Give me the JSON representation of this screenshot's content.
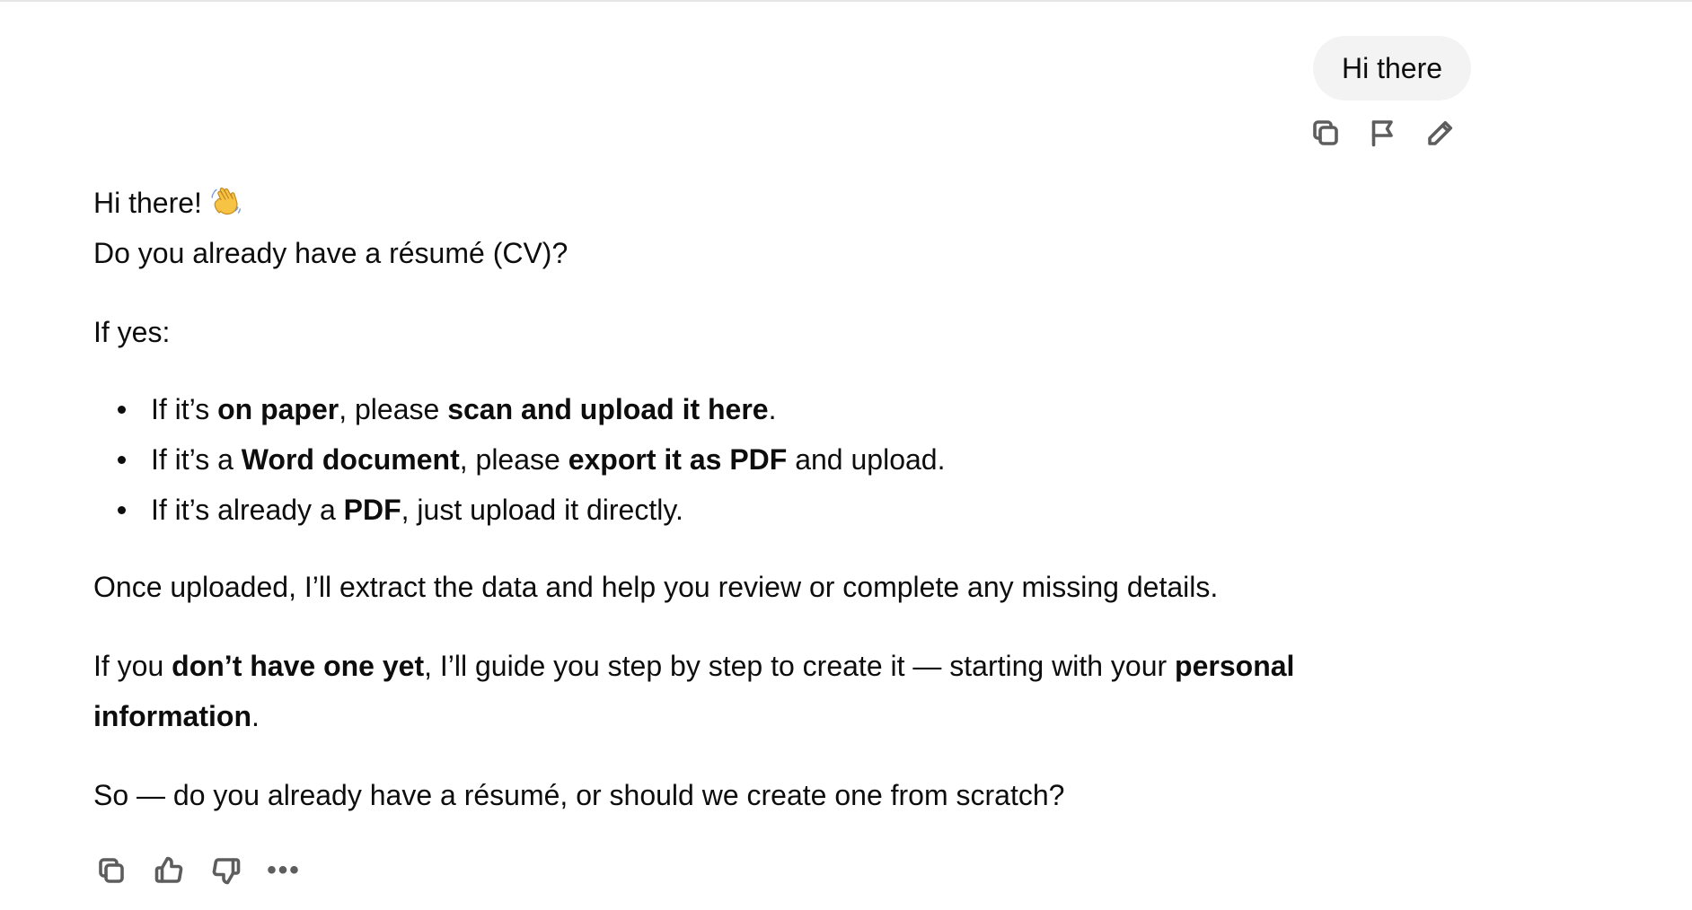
{
  "user_message": {
    "text": "Hi there"
  },
  "assistant_message": {
    "greeting": "Hi there!",
    "greeting_emoji": "waving-hand-icon",
    "question": "Do you already have a résumé (CV)?",
    "if_yes": "If yes:",
    "options": [
      {
        "pre": "If it’s ",
        "b1": "on paper",
        "mid": ", please ",
        "b2": "scan and upload it here",
        "post": "."
      },
      {
        "pre": "If it’s a ",
        "b1": "Word document",
        "mid": ", please ",
        "b2": "export it as PDF",
        "post": " and upload."
      },
      {
        "pre": "If it’s already a ",
        "b1": "PDF",
        "mid": ", just upload it directly.",
        "b2": "",
        "post": ""
      }
    ],
    "once_uploaded": "Once uploaded, I’ll extract the data and help you review or complete any missing details.",
    "no_cv": {
      "pre": "If you ",
      "b1": "don’t have one yet",
      "mid": ", I’ll guide you step by step to create it — starting with your ",
      "b2": "personal information",
      "post": "."
    },
    "closing": "So — do you already have a résumé, or should we create one from scratch?"
  },
  "user_actions": [
    "copy-icon",
    "flag-icon",
    "edit-icon"
  ],
  "assistant_actions": [
    "copy-icon",
    "thumbs-up-icon",
    "thumbs-down-icon",
    "more-icon"
  ],
  "more_glyph": "•••",
  "colors": {
    "bubble": "#f3f3f3",
    "text": "#0d0d0d",
    "icon": "#5d5d5d"
  }
}
